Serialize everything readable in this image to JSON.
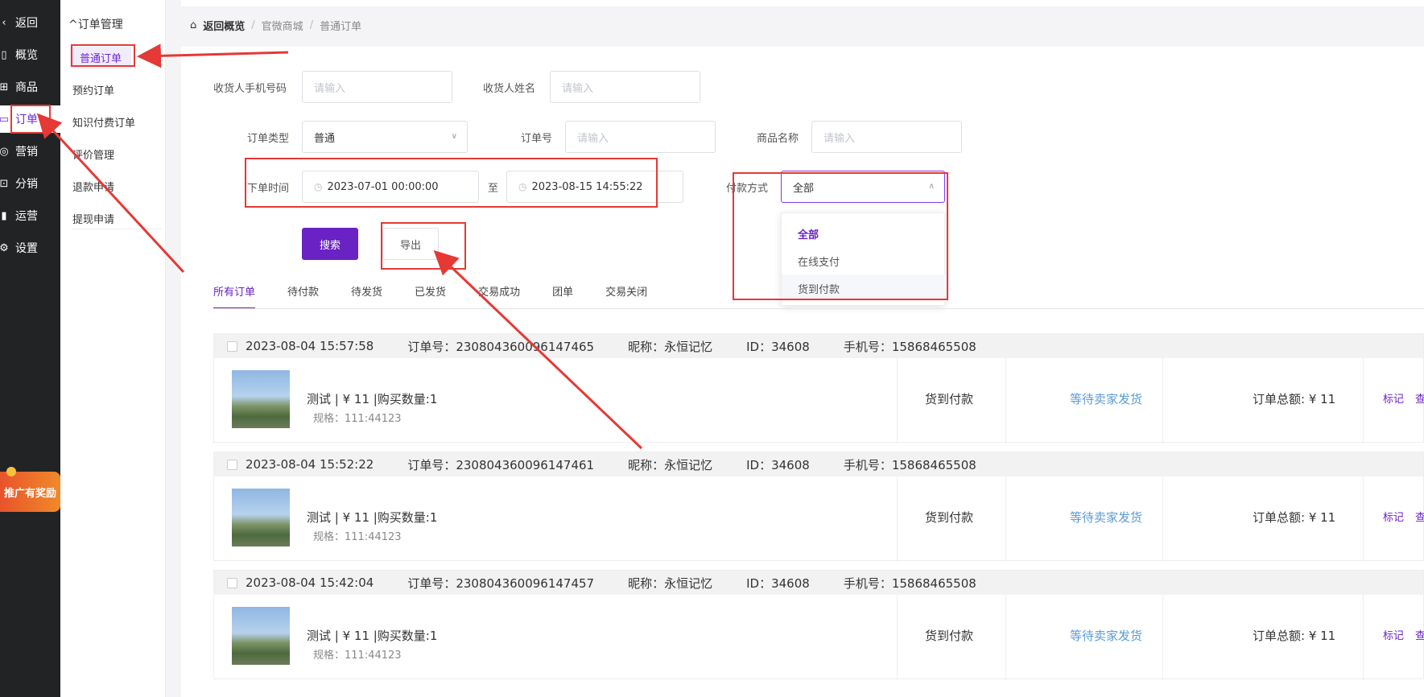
{
  "sidebar": {
    "items": [
      {
        "label": "返回",
        "icon": "chevron-left-icon",
        "glyph": "‹"
      },
      {
        "label": "概览",
        "icon": "overview-icon",
        "glyph": "▯"
      },
      {
        "label": "商品",
        "icon": "goods-icon",
        "glyph": "⊞"
      },
      {
        "label": "订单",
        "icon": "order-icon",
        "glyph": "▭"
      },
      {
        "label": "营销",
        "icon": "marketing-icon",
        "glyph": "◎"
      },
      {
        "label": "分销",
        "icon": "distribution-icon",
        "glyph": "⊡"
      },
      {
        "label": "运营",
        "icon": "operation-icon",
        "glyph": "▮"
      },
      {
        "label": "设置",
        "icon": "settings-icon",
        "glyph": "⚙"
      }
    ],
    "promo": "推广有奖励"
  },
  "submenu": {
    "title": "订单管理",
    "items": [
      "普通订单",
      "预约订单",
      "知识付费订单",
      "评价管理",
      "退款申请",
      "提现申请"
    ]
  },
  "breadcrumb": [
    "返回概览",
    "官微商城",
    "普通订单"
  ],
  "filters": {
    "phone": {
      "label": "收货人手机号码",
      "placeholder": "请输入"
    },
    "name": {
      "label": "收货人姓名",
      "placeholder": "请输入"
    },
    "order_type": {
      "label": "订单类型",
      "value": "普通"
    },
    "order_no": {
      "label": "订单号",
      "placeholder": "请输入"
    },
    "goods_name": {
      "label": "商品名称",
      "placeholder": "请输入"
    },
    "time": {
      "label": "下单时间",
      "start": "2023-07-01 00:00:00",
      "separator": "至",
      "end": "2023-08-15 14:55:22"
    },
    "payment": {
      "label": "付款方式",
      "value": "全部",
      "options": [
        "全部",
        "在线支付",
        "货到付款"
      ]
    }
  },
  "buttons": {
    "search": "搜索",
    "export": "导出"
  },
  "tabs": [
    "所有订单",
    "待付款",
    "待发货",
    "已发货",
    "交易成功",
    "团单",
    "交易关闭"
  ],
  "orders": [
    {
      "time": "2023-08-04 15:57:58",
      "order_no": "订单号：230804360096147465",
      "nickname": "昵称：永恒记忆",
      "id": "ID：34608",
      "phone": "手机号：15868465508",
      "product": "测试 | ¥ 11 |购买数量:1",
      "spec": "规格：111:44123",
      "payment": "货到付款",
      "status": "等待卖家发货",
      "total": "订单总额: ¥ 11",
      "mark": "标记",
      "view": "查"
    },
    {
      "time": "2023-08-04 15:52:22",
      "order_no": "订单号：230804360096147461",
      "nickname": "昵称：永恒记忆",
      "id": "ID：34608",
      "phone": "手机号：15868465508",
      "product": "测试 | ¥ 11 |购买数量:1",
      "spec": "规格：111:44123",
      "payment": "货到付款",
      "status": "等待卖家发货",
      "total": "订单总额: ¥ 11",
      "mark": "标记",
      "view": "查"
    },
    {
      "time": "2023-08-04 15:42:04",
      "order_no": "订单号：230804360096147457",
      "nickname": "昵称：永恒记忆",
      "id": "ID：34608",
      "phone": "手机号：15868465508",
      "product": "测试 | ¥ 11 |购买数量:1",
      "spec": "规格：111:44123",
      "payment": "货到付款",
      "status": "等待卖家发货",
      "total": "订单总额: ¥ 11",
      "mark": "标记",
      "view": "查"
    }
  ],
  "colors": {
    "accent": "#6a22c4",
    "sidebar": "#222325",
    "status_link": "#5b9bd5",
    "annotation": "#e53935"
  }
}
